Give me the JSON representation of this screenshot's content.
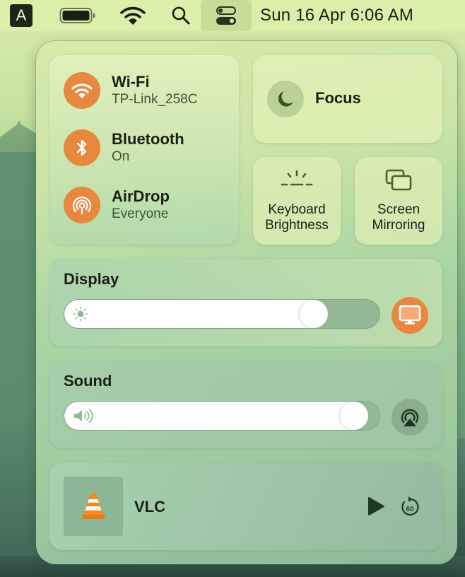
{
  "menubar": {
    "input_source": "A",
    "battery_icon": "battery-icon",
    "wifi_icon": "wifi-icon",
    "search_icon": "search-icon",
    "control_center_icon": "control-center-icon",
    "clock": "Sun 16 Apr  6:06 AM"
  },
  "control_center": {
    "accent_color": "#e8883e",
    "network": [
      {
        "id": "wifi",
        "icon": "wifi-icon",
        "title": "Wi-Fi",
        "subtitle": "TP-Link_258C",
        "active": true
      },
      {
        "id": "bluetooth",
        "icon": "bluetooth-icon",
        "title": "Bluetooth",
        "subtitle": "On",
        "active": true
      },
      {
        "id": "airdrop",
        "icon": "airdrop-icon",
        "title": "AirDrop",
        "subtitle": "Everyone",
        "active": true
      }
    ],
    "focus": {
      "icon": "moon-icon",
      "label": "Focus"
    },
    "keyboard_brightness": {
      "icon": "keyboard-brightness-icon",
      "label_line1": "Keyboard",
      "label_line2": "Brightness"
    },
    "screen_mirroring": {
      "icon": "screen-mirroring-icon",
      "label_line1": "Screen",
      "label_line2": "Mirroring"
    },
    "display": {
      "title": "Display",
      "icon": "sun-icon",
      "brightness_percent": 82,
      "side_button_icon": "display-icon"
    },
    "sound": {
      "title": "Sound",
      "icon": "speaker-icon",
      "volume_percent": 96,
      "side_button_icon": "airplay-audio-icon"
    },
    "now_playing": {
      "app": "VLC",
      "artwork_icon": "vlc-cone-icon",
      "play_icon": "play-icon",
      "skip_icon": "skip-forward-60-icon",
      "skip_label": "60"
    }
  }
}
